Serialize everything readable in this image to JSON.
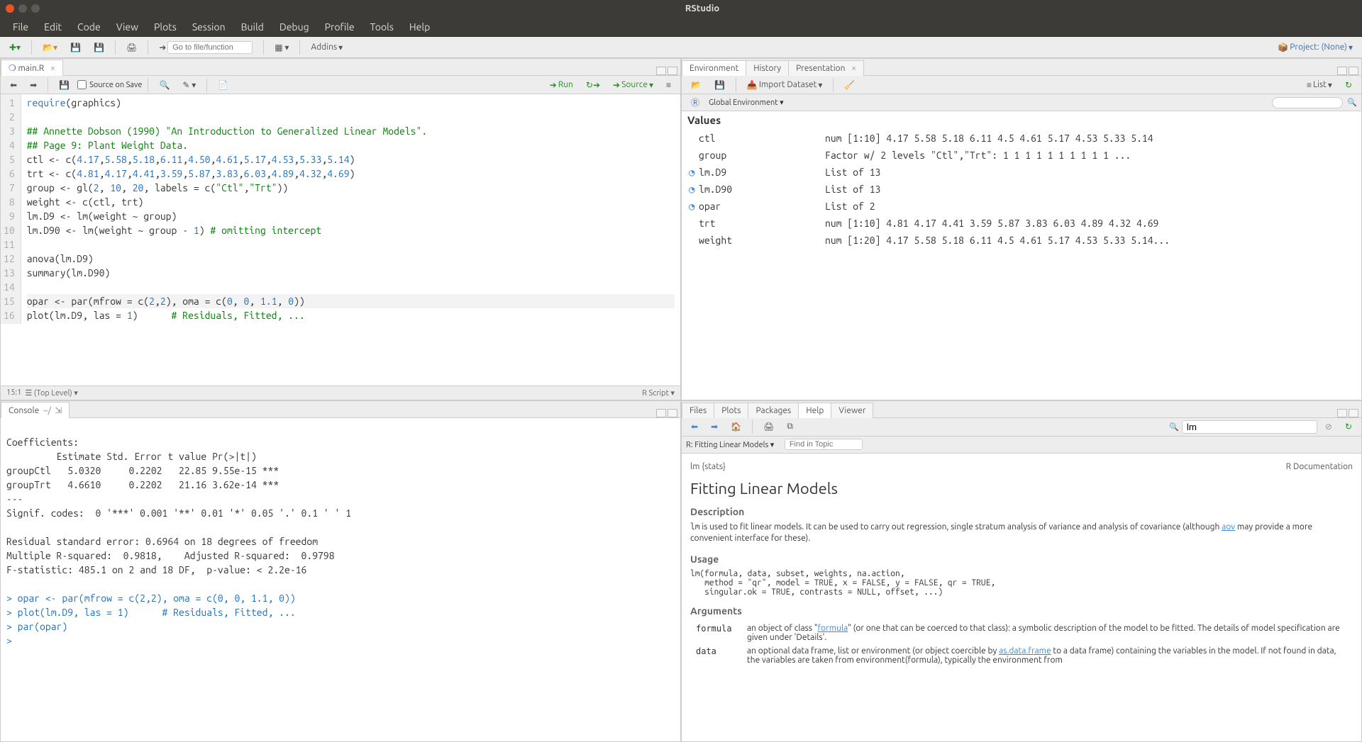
{
  "window": {
    "title": "RStudio"
  },
  "menubar": [
    "File",
    "Edit",
    "Code",
    "View",
    "Plots",
    "Session",
    "Build",
    "Debug",
    "Profile",
    "Tools",
    "Help"
  ],
  "maintoolbar": {
    "goto_placeholder": "Go to file/function",
    "addins": "Addins",
    "project_label": "Project: (None)"
  },
  "source": {
    "tab": "main.R",
    "source_on_save": "Source on Save",
    "run": "Run",
    "source_btn": "Source",
    "cursor": "15:1",
    "scope": "(Top Level)",
    "lang": "R Script",
    "lines": [
      {
        "n": 1,
        "html": "<span class='kw'>require</span>(graphics)"
      },
      {
        "n": 2,
        "html": ""
      },
      {
        "n": 3,
        "html": "<span class='cmt'>## Annette Dobson (1990) \"An Introduction to Generalized Linear Models\".</span>"
      },
      {
        "n": 4,
        "html": "<span class='cmt'>## Page 9: Plant Weight Data.</span>"
      },
      {
        "n": 5,
        "html": "ctl &lt;- c(<span class='num'>4.17</span>,<span class='num'>5.58</span>,<span class='num'>5.18</span>,<span class='num'>6.11</span>,<span class='num'>4.50</span>,<span class='num'>4.61</span>,<span class='num'>5.17</span>,<span class='num'>4.53</span>,<span class='num'>5.33</span>,<span class='num'>5.14</span>)"
      },
      {
        "n": 6,
        "html": "trt &lt;- c(<span class='num'>4.81</span>,<span class='num'>4.17</span>,<span class='num'>4.41</span>,<span class='num'>3.59</span>,<span class='num'>5.87</span>,<span class='num'>3.83</span>,<span class='num'>6.03</span>,<span class='num'>4.89</span>,<span class='num'>4.32</span>,<span class='num'>4.69</span>)"
      },
      {
        "n": 7,
        "html": "group &lt;- gl(<span class='num'>2</span>, <span class='num'>10</span>, <span class='num'>20</span>, labels = c(<span class='str'>\"Ctl\"</span>,<span class='str'>\"Trt\"</span>))"
      },
      {
        "n": 8,
        "html": "weight &lt;- c(ctl, trt)"
      },
      {
        "n": 9,
        "html": "lm.D9 &lt;- lm(weight ~ group)"
      },
      {
        "n": 10,
        "html": "lm.D90 &lt;- lm(weight ~ group - <span class='num'>1</span>) <span class='cmt'># omitting intercept</span>"
      },
      {
        "n": 11,
        "html": ""
      },
      {
        "n": 12,
        "html": "anova(lm.D9)"
      },
      {
        "n": 13,
        "html": "summary(lm.D90)"
      },
      {
        "n": 14,
        "html": ""
      },
      {
        "n": 15,
        "html": "opar &lt;- par(mfrow = c(<span class='num'>2</span>,<span class='num'>2</span>), oma = c(<span class='num'>0</span>, <span class='num'>0</span>, <span class='num'>1.1</span>, <span class='num'>0</span>))",
        "hl": true
      },
      {
        "n": 16,
        "html": "plot(lm.D9, las = <span class='num'>1</span>)      <span class='cmt'># Residuals, Fitted, ...</span>"
      }
    ]
  },
  "console": {
    "title": "Console",
    "cwd": "~/",
    "lines": [
      "",
      "Coefficients:",
      "         Estimate Std. Error t value Pr(>|t|)    ",
      "groupCtl   5.0320     0.2202   22.85 9.55e-15 ***",
      "groupTrt   4.6610     0.2202   21.16 3.62e-14 ***",
      "---",
      "Signif. codes:  0 '***' 0.001 '**' 0.01 '*' 0.05 '.' 0.1 ' ' 1",
      "",
      "Residual standard error: 0.6964 on 18 degrees of freedom",
      "Multiple R-squared:  0.9818,\tAdjusted R-squared:  0.9798 ",
      "F-statistic: 485.1 on 2 and 18 DF,  p-value: < 2.2e-16",
      ""
    ],
    "prompts": [
      "> opar <- par(mfrow = c(2,2), oma = c(0, 0, 1.1, 0))",
      "> plot(lm.D9, las = 1)      # Residuals, Fitted, ...",
      "> par(opar)",
      "> "
    ]
  },
  "env": {
    "tabs": [
      "Environment",
      "History",
      "Presentation"
    ],
    "active_tab": 0,
    "import": "Import Dataset",
    "scope": "Global Environment",
    "list_mode": "List",
    "section": "Values",
    "rows": [
      {
        "name": "ctl",
        "value": "num [1:10] 4.17 5.58 5.18 6.11 4.5 4.61 5.17 4.53 5.33 5.14"
      },
      {
        "name": "group",
        "value": "Factor w/ 2 levels \"Ctl\",\"Trt\": 1 1 1 1 1 1 1 1 1 1 ..."
      },
      {
        "name": "lm.D9",
        "value": "List of 13",
        "expand": true
      },
      {
        "name": "lm.D90",
        "value": "List of 13",
        "expand": true
      },
      {
        "name": "opar",
        "value": "List of 2",
        "expand": true
      },
      {
        "name": "trt",
        "value": "num [1:10] 4.81 4.17 4.41 3.59 5.87 3.83 6.03 4.89 4.32 4.69"
      },
      {
        "name": "weight",
        "value": "num [1:20] 4.17 5.58 5.18 6.11 4.5 4.61 5.17 4.53 5.33 5.14..."
      }
    ]
  },
  "help": {
    "tabs": [
      "Files",
      "Plots",
      "Packages",
      "Help",
      "Viewer"
    ],
    "active_tab": 3,
    "breadcrumb": "R: Fitting Linear Models",
    "find_placeholder": "Find in Topic",
    "search_value": "lm",
    "topic_ns": "lm {stats}",
    "doc_label": "R Documentation",
    "title": "Fitting Linear Models",
    "desc_h": "Description",
    "desc_p1a": "lm",
    "desc_p1b": " is used to fit linear models. It can be used to carry out regression, single stratum analysis of variance and analysis of covariance (although ",
    "desc_link": "aov",
    "desc_p1c": " may provide a more convenient interface for these).",
    "usage_h": "Usage",
    "usage_code": "lm(formula, data, subset, weights, na.action,\n   method = \"qr\", model = TRUE, x = FALSE, y = FALSE, qr = TRUE,\n   singular.ok = TRUE, contrasts = NULL, offset, ...)",
    "args_h": "Arguments",
    "args": [
      {
        "name": "formula",
        "desc_a": "an object of class \"",
        "link": "formula",
        "desc_b": "\" (or one that can be coerced to that class): a symbolic description of the model to be fitted. The details of model specification are given under 'Details'."
      },
      {
        "name": "data",
        "desc_a": "an optional data frame, list or environment (or object coercible by ",
        "link": "as.data.frame",
        "desc_b": " to a data frame) containing the variables in the model. If not found in data, the variables are taken from environment(formula), typically the environment from"
      }
    ]
  }
}
